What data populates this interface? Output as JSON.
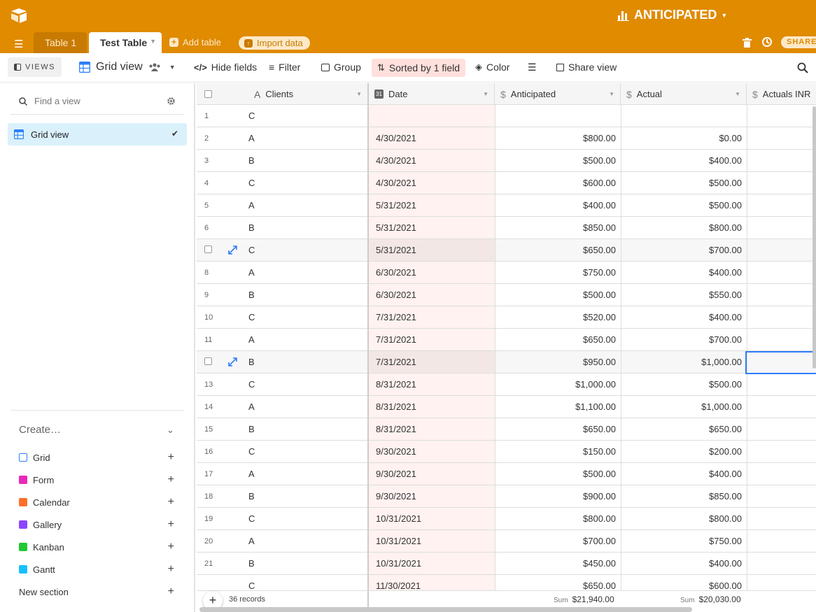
{
  "app": {
    "base_name": "ANTICIPATED",
    "colors": {
      "accent": "#e08b00",
      "selection": "#2d7ff9",
      "sorted_bg": "#ffe0dc",
      "view_selected": "#daf1fc"
    }
  },
  "tabs": [
    {
      "label": "Table 1",
      "active": false
    },
    {
      "label": "Test Table",
      "active": true
    }
  ],
  "tabbar": {
    "add_table": "Add table",
    "import_data": "Import data",
    "share": "SHARE"
  },
  "viewbar": {
    "views_label": "VIEWS",
    "view_name": "Grid view",
    "hide_fields": "Hide fields",
    "filter": "Filter",
    "group": "Group",
    "sorted": "Sorted by 1 field",
    "color": "Color",
    "share_view": "Share view"
  },
  "sidebar": {
    "find_placeholder": "Find a view",
    "views": [
      {
        "name": "Grid view",
        "selected": true
      }
    ],
    "create_label": "Create…",
    "create_items": [
      {
        "label": "Grid",
        "icon": "grid-icon",
        "color": "#2d7ff9"
      },
      {
        "label": "Form",
        "icon": "form-icon",
        "color": "#e929ba"
      },
      {
        "label": "Calendar",
        "icon": "calendar-icon",
        "color": "#ff6f2c"
      },
      {
        "label": "Gallery",
        "icon": "gallery-icon",
        "color": "#8b46ff"
      },
      {
        "label": "Kanban",
        "icon": "kanban-icon",
        "color": "#20c933"
      },
      {
        "label": "Gantt",
        "icon": "gantt-icon",
        "color": "#18bfff"
      }
    ],
    "new_section": "New section"
  },
  "grid": {
    "columns": [
      {
        "name": "Clients",
        "icon": "text-icon"
      },
      {
        "name": "Date",
        "icon": "date-icon"
      },
      {
        "name": "Anticipated",
        "icon": "currency-icon"
      },
      {
        "name": "Actual",
        "icon": "currency-icon"
      },
      {
        "name": "Actuals INR",
        "icon": "currency-icon"
      }
    ],
    "rows": [
      {
        "num": "1",
        "client": "C",
        "date": "",
        "anticipated": "",
        "actual": ""
      },
      {
        "num": "2",
        "client": "A",
        "date": "4/30/2021",
        "anticipated": "$800.00",
        "actual": "$0.00"
      },
      {
        "num": "3",
        "client": "B",
        "date": "4/30/2021",
        "anticipated": "$500.00",
        "actual": "$400.00"
      },
      {
        "num": "4",
        "client": "C",
        "date": "4/30/2021",
        "anticipated": "$600.00",
        "actual": "$500.00"
      },
      {
        "num": "5",
        "client": "A",
        "date": "5/31/2021",
        "anticipated": "$400.00",
        "actual": "$500.00"
      },
      {
        "num": "6",
        "client": "B",
        "date": "5/31/2021",
        "anticipated": "$850.00",
        "actual": "$800.00"
      },
      {
        "num": "",
        "client": "C",
        "date": "5/31/2021",
        "anticipated": "$650.00",
        "actual": "$700.00",
        "hover": true
      },
      {
        "num": "8",
        "client": "A",
        "date": "6/30/2021",
        "anticipated": "$750.00",
        "actual": "$400.00"
      },
      {
        "num": "9",
        "client": "B",
        "date": "6/30/2021",
        "anticipated": "$500.00",
        "actual": "$550.00"
      },
      {
        "num": "10",
        "client": "C",
        "date": "7/31/2021",
        "anticipated": "$520.00",
        "actual": "$400.00"
      },
      {
        "num": "11",
        "client": "A",
        "date": "7/31/2021",
        "anticipated": "$650.00",
        "actual": "$700.00"
      },
      {
        "num": "",
        "client": "B",
        "date": "7/31/2021",
        "anticipated": "$950.00",
        "actual": "$1,000.00",
        "hover": true
      },
      {
        "num": "13",
        "client": "C",
        "date": "8/31/2021",
        "anticipated": "$1,000.00",
        "actual": "$500.00"
      },
      {
        "num": "14",
        "client": "A",
        "date": "8/31/2021",
        "anticipated": "$1,100.00",
        "actual": "$1,000.00"
      },
      {
        "num": "15",
        "client": "B",
        "date": "8/31/2021",
        "anticipated": "$650.00",
        "actual": "$650.00"
      },
      {
        "num": "16",
        "client": "C",
        "date": "9/30/2021",
        "anticipated": "$150.00",
        "actual": "$200.00"
      },
      {
        "num": "17",
        "client": "A",
        "date": "9/30/2021",
        "anticipated": "$500.00",
        "actual": "$400.00"
      },
      {
        "num": "18",
        "client": "B",
        "date": "9/30/2021",
        "anticipated": "$900.00",
        "actual": "$850.00"
      },
      {
        "num": "19",
        "client": "C",
        "date": "10/31/2021",
        "anticipated": "$800.00",
        "actual": "$800.00"
      },
      {
        "num": "20",
        "client": "A",
        "date": "10/31/2021",
        "anticipated": "$700.00",
        "actual": "$750.00"
      },
      {
        "num": "21",
        "client": "B",
        "date": "10/31/2021",
        "anticipated": "$450.00",
        "actual": "$400.00"
      },
      {
        "num": "",
        "client": "C",
        "date": "11/30/2021",
        "anticipated": "$650.00",
        "actual": "$600.00"
      }
    ],
    "footer": {
      "records": "36 records",
      "sum_label": "Sum",
      "anticipated_sum": "$21,940.00",
      "actual_sum": "$20,030.00"
    }
  }
}
